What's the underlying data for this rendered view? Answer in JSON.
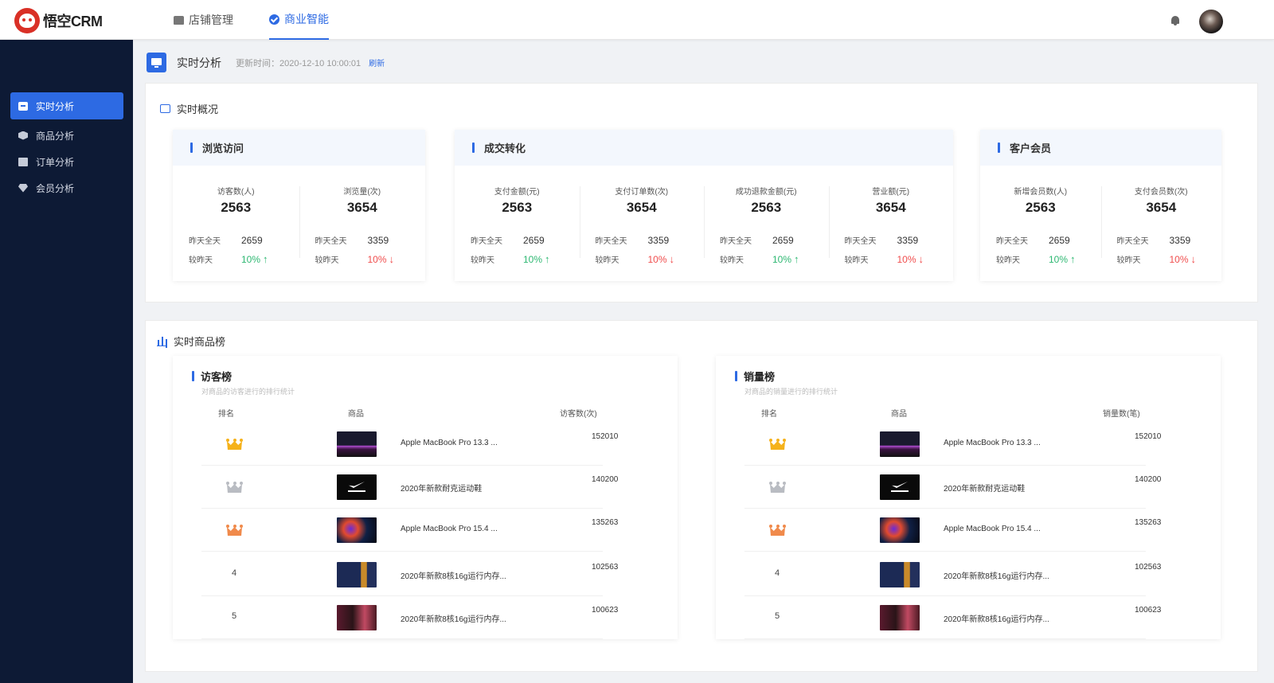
{
  "app": {
    "logo_text": "悟空CRM"
  },
  "topnav": {
    "items": [
      {
        "label": "店铺管理",
        "icon": "store-icon"
      },
      {
        "label": "商业智能",
        "icon": "check-badge-icon",
        "active": true
      }
    ]
  },
  "sidebar": {
    "items": [
      {
        "label": "实时分析",
        "icon": "monitor-icon",
        "active": true
      },
      {
        "label": "商品分析",
        "icon": "cube-icon"
      },
      {
        "label": "订单分析",
        "icon": "archive-icon"
      },
      {
        "label": "会员分析",
        "icon": "diamond-icon"
      }
    ]
  },
  "page": {
    "title": "实时分析",
    "update_time": "更新时间：2020-12-10  10:00:01",
    "refresh": "刷新"
  },
  "overview": {
    "title": "实时概况",
    "cards": [
      {
        "title": "浏览访问",
        "metrics": [
          {
            "label": "访客数(人)",
            "value": "2563",
            "yday_label": "昨天全天",
            "yday_value": "2659",
            "cmp_label": "较昨天",
            "cmp_value": "10%",
            "trend": "up"
          },
          {
            "label": "浏览量(次)",
            "value": "3654",
            "yday_label": "昨天全天",
            "yday_value": "3359",
            "cmp_label": "较昨天",
            "cmp_value": "10%",
            "trend": "down"
          }
        ]
      },
      {
        "title": "成交转化",
        "metrics": [
          {
            "label": "支付金额(元)",
            "value": "2563",
            "yday_label": "昨天全天",
            "yday_value": "2659",
            "cmp_label": "较昨天",
            "cmp_value": "10%",
            "trend": "up"
          },
          {
            "label": "支付订单数(次)",
            "value": "3654",
            "yday_label": "昨天全天",
            "yday_value": "3359",
            "cmp_label": "较昨天",
            "cmp_value": "10%",
            "trend": "down"
          },
          {
            "label": "成功退款金额(元)",
            "value": "2563",
            "yday_label": "昨天全天",
            "yday_value": "2659",
            "cmp_label": "较昨天",
            "cmp_value": "10%",
            "trend": "up"
          },
          {
            "label": "营业额(元)",
            "value": "3654",
            "yday_label": "昨天全天",
            "yday_value": "3359",
            "cmp_label": "较昨天",
            "cmp_value": "10%",
            "trend": "down"
          }
        ]
      },
      {
        "title": "客户会员",
        "metrics": [
          {
            "label": "新增会员数(人)",
            "value": "2563",
            "yday_label": "昨天全天",
            "yday_value": "2659",
            "cmp_label": "较昨天",
            "cmp_value": "10%",
            "trend": "up"
          },
          {
            "label": "支付会员数(次)",
            "value": "3654",
            "yday_label": "昨天全天",
            "yday_value": "3359",
            "cmp_label": "较昨天",
            "cmp_value": "10%",
            "trend": "down"
          }
        ]
      }
    ],
    "trend_symbols": {
      "up": "↑",
      "down": "↓"
    },
    "trend_colors": {
      "up": "#2eb872",
      "down": "#f04d4d"
    }
  },
  "ranking": {
    "title": "实时商品榜",
    "boards": [
      {
        "title": "访客榜",
        "subtitle": "对商品的访客进行的排行统计",
        "col_rank": "排名",
        "col_goods": "商品",
        "col_value": "访客数(次)",
        "rows": [
          {
            "rank": "1",
            "crown": "gold",
            "thumb": "macbook-thumb",
            "name": "Apple MacBook Pro 13.3 ...",
            "value": "152010"
          },
          {
            "rank": "2",
            "crown": "silver",
            "thumb": "nike-thumb",
            "name": "2020年新款耐克运动鞋",
            "value": "140200"
          },
          {
            "rank": "3",
            "crown": "bronze",
            "thumb": "m1-thumb",
            "name": "Apple MacBook Pro 15.4 ...",
            "value": "135263"
          },
          {
            "rank": "4",
            "crown": "",
            "thumb": "screen-thumb",
            "name": "2020年新款8核16g运行内存...",
            "value": "102563"
          },
          {
            "rank": "5",
            "crown": "",
            "thumb": "screen2-thumb",
            "name": "2020年新款8核16g运行内存...",
            "value": "100623"
          }
        ]
      },
      {
        "title": "销量榜",
        "subtitle": "对商品的销量进行的排行统计",
        "col_rank": "排名",
        "col_goods": "商品",
        "col_value": "销量数(笔)",
        "rows": [
          {
            "rank": "1",
            "crown": "gold",
            "thumb": "macbook-thumb",
            "name": "Apple MacBook Pro 13.3 ...",
            "value": "152010"
          },
          {
            "rank": "2",
            "crown": "silver",
            "thumb": "nike-thumb",
            "name": "2020年新款耐克运动鞋",
            "value": "140200"
          },
          {
            "rank": "3",
            "crown": "bronze",
            "thumb": "m1-thumb",
            "name": "Apple MacBook Pro 15.4 ...",
            "value": "135263"
          },
          {
            "rank": "4",
            "crown": "",
            "thumb": "screen-thumb",
            "name": "2020年新款8核16g运行内存...",
            "value": "102563"
          },
          {
            "rank": "5",
            "crown": "",
            "thumb": "screen2-thumb",
            "name": "2020年新款8核16g运行内存...",
            "value": "100623"
          }
        ]
      }
    ]
  },
  "colors": {
    "accent": "#2d6ae3",
    "sidebar_bg": "#0d1a35",
    "up": "#2eb872",
    "down": "#f04d4d"
  }
}
